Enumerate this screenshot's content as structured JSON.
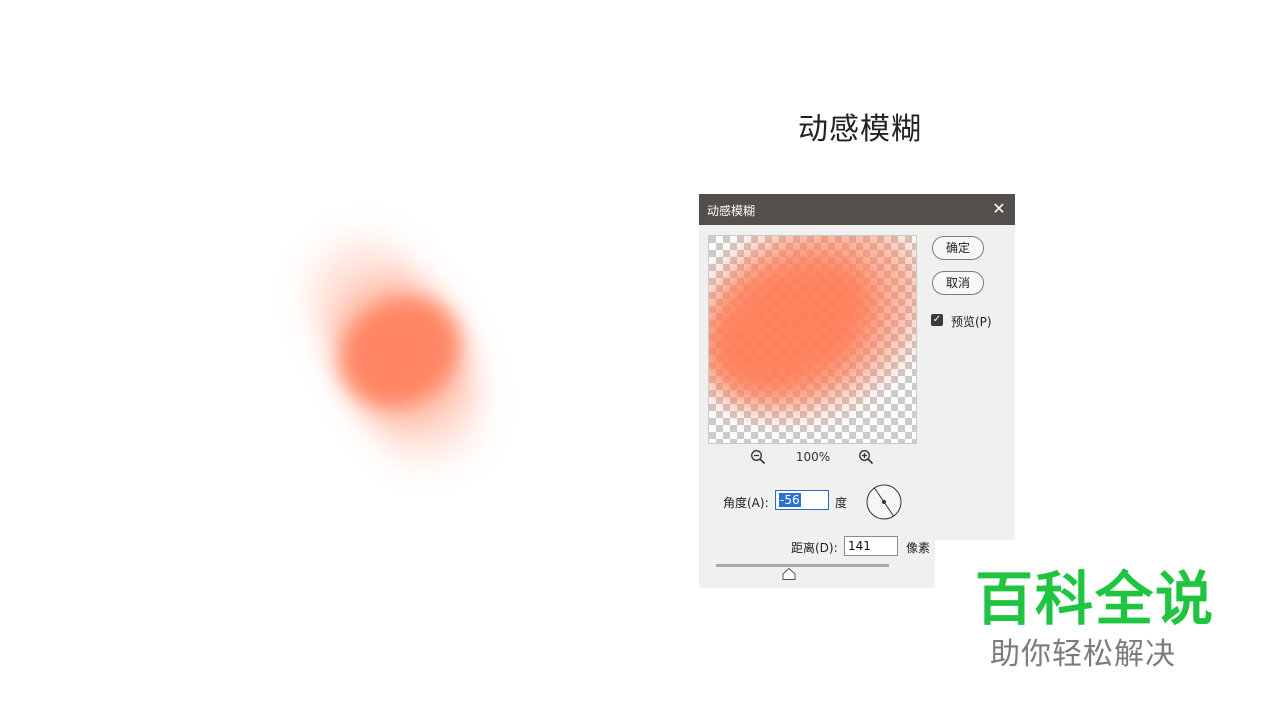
{
  "slide": {
    "title": "动感模糊"
  },
  "dialog": {
    "title": "动感模糊",
    "close_symbol": "✕",
    "ok_label": "确定",
    "cancel_label": "取消",
    "preview_label": "预览(P)",
    "preview_checked": true,
    "zoom_level": "100%",
    "angle_label": "角度(A):",
    "angle_value": "-56",
    "angle_unit": "度",
    "distance_label": "距离(D):",
    "distance_value": "141",
    "distance_unit": "像素"
  },
  "colors": {
    "blob": "#ff7e5a",
    "titlebar": "#534f4b",
    "dialog_bg": "#f0f0ee",
    "watermark_green": "#1fc441",
    "watermark_gray": "#7c7c7c"
  },
  "icons": {
    "close": "close-icon",
    "zoom_out": "zoom-out-icon",
    "zoom_in": "zoom-in-icon",
    "angle_dial": "angle-dial-icon",
    "check": "check-icon",
    "slider": "slider-handle-icon"
  },
  "watermark": {
    "title": "百科全说",
    "subtitle": "助你轻松解决"
  }
}
